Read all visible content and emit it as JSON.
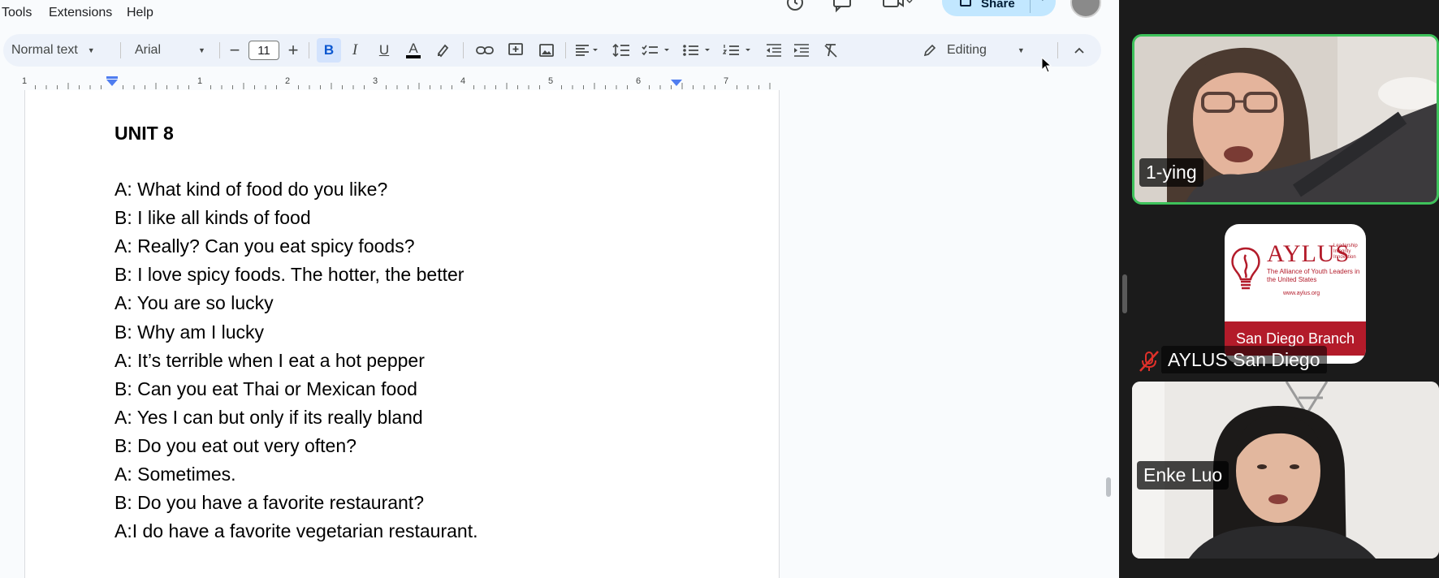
{
  "menu": {
    "tools": "Tools",
    "extensions": "Extensions",
    "help": "Help"
  },
  "share": {
    "label": "Share"
  },
  "toolbar": {
    "style": "Normal text",
    "font": "Arial",
    "font_size": "11",
    "bold": "B",
    "italic": "I",
    "underline": "U",
    "text_color": "A",
    "mode": "Editing"
  },
  "ruler": {
    "labels": [
      "1",
      "1",
      "2",
      "3",
      "4",
      "5",
      "6",
      "7"
    ]
  },
  "document": {
    "heading": "UNIT 8",
    "lines": [
      "A: What kind of food do you like?",
      "B: I like all kinds of food",
      "A: Really? Can you eat spicy foods?",
      "B: I love spicy foods. The hotter, the better",
      "A: You are so lucky",
      "B: Why am I lucky",
      "A: It’s terrible when I eat a hot pepper",
      "B: Can you eat Thai or Mexican food",
      "A: Yes I can but only if its really bland",
      "B: Do you eat out very often?",
      "A: Sometimes.",
      "B: Do you have a favorite restaurant?",
      "A:I do have a favorite vegetarian restaurant."
    ]
  },
  "participants": [
    {
      "name": "1-ying"
    },
    {
      "name": "AYLUS San Diego",
      "muted": true
    },
    {
      "name": "Enke Luo"
    }
  ],
  "logo": {
    "title": "AYLUS",
    "tagline": [
      "Leadership",
      "Integrity",
      "Innovation"
    ],
    "subtitle": "The Alliance of Youth Leaders in the United States",
    "url": "www.aylus.org",
    "branch": "San Diego Branch"
  },
  "colors": {
    "active_speaker_border": "#3ec25b",
    "brand_red": "#b31b2a",
    "toolbar_bg": "#edf2fa",
    "share_bg": "#c2e7ff"
  }
}
